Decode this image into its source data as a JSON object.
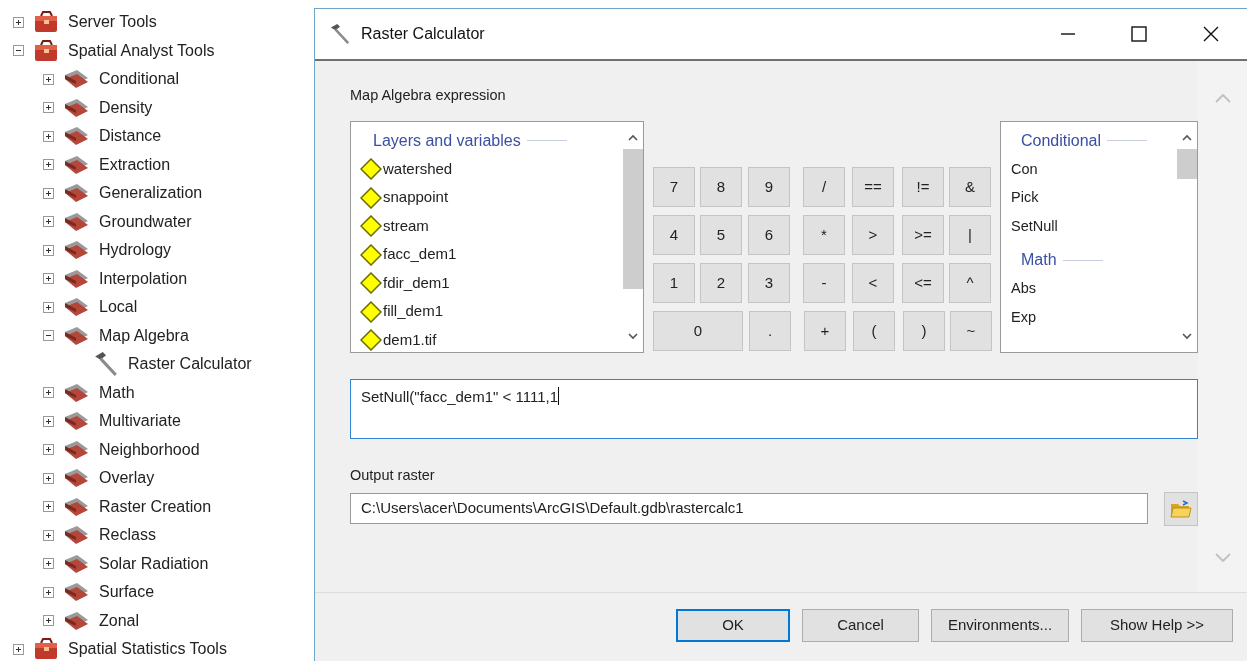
{
  "tree": [
    {
      "label": "Server Tools",
      "kind": "toolbox",
      "expanded": false
    },
    {
      "label": "Spatial Analyst Tools",
      "kind": "toolbox",
      "expanded": true,
      "children": [
        {
          "label": "Conditional",
          "kind": "toolset",
          "expanded": false
        },
        {
          "label": "Density",
          "kind": "toolset",
          "expanded": false
        },
        {
          "label": "Distance",
          "kind": "toolset",
          "expanded": false
        },
        {
          "label": "Extraction",
          "kind": "toolset",
          "expanded": false
        },
        {
          "label": "Generalization",
          "kind": "toolset",
          "expanded": false
        },
        {
          "label": "Groundwater",
          "kind": "toolset",
          "expanded": false
        },
        {
          "label": "Hydrology",
          "kind": "toolset",
          "expanded": false
        },
        {
          "label": "Interpolation",
          "kind": "toolset",
          "expanded": false
        },
        {
          "label": "Local",
          "kind": "toolset",
          "expanded": false
        },
        {
          "label": "Map Algebra",
          "kind": "toolset",
          "expanded": true,
          "children": [
            {
              "label": "Raster Calculator",
              "kind": "tool"
            }
          ]
        },
        {
          "label": "Math",
          "kind": "toolset",
          "expanded": false
        },
        {
          "label": "Multivariate",
          "kind": "toolset",
          "expanded": false
        },
        {
          "label": "Neighborhood",
          "kind": "toolset",
          "expanded": false
        },
        {
          "label": "Overlay",
          "kind": "toolset",
          "expanded": false
        },
        {
          "label": "Raster Creation",
          "kind": "toolset",
          "expanded": false
        },
        {
          "label": "Reclass",
          "kind": "toolset",
          "expanded": false
        },
        {
          "label": "Solar Radiation",
          "kind": "toolset",
          "expanded": false
        },
        {
          "label": "Surface",
          "kind": "toolset",
          "expanded": false
        },
        {
          "label": "Zonal",
          "kind": "toolset",
          "expanded": false
        }
      ]
    },
    {
      "label": "Spatial Statistics Tools",
      "kind": "toolbox",
      "expanded": false
    }
  ],
  "window": {
    "title": "Raster Calculator"
  },
  "expression_label": "Map Algebra expression",
  "layers": {
    "header": "Layers and variables",
    "items": [
      "watershed",
      "snappoint",
      "stream",
      "facc_dem1",
      "fdir_dem1",
      "fill_dem1",
      "dem1.tif"
    ]
  },
  "keypad": [
    [
      {
        "label": "7",
        "kind": "normal"
      },
      {
        "label": "8",
        "kind": "normal"
      },
      {
        "label": "9",
        "kind": "normal"
      },
      {
        "label": "/",
        "kind": "normal"
      },
      {
        "label": "==",
        "kind": "normal"
      },
      {
        "label": "!=",
        "kind": "normal"
      },
      {
        "label": "&",
        "kind": "normal"
      }
    ],
    [
      {
        "label": "4",
        "kind": "normal"
      },
      {
        "label": "5",
        "kind": "normal"
      },
      {
        "label": "6",
        "kind": "normal"
      },
      {
        "label": "*",
        "kind": "normal"
      },
      {
        "label": ">",
        "kind": "normal"
      },
      {
        "label": ">=",
        "kind": "normal"
      },
      {
        "label": "|",
        "kind": "normal"
      }
    ],
    [
      {
        "label": "1",
        "kind": "normal"
      },
      {
        "label": "2",
        "kind": "normal"
      },
      {
        "label": "3",
        "kind": "normal"
      },
      {
        "label": "-",
        "kind": "normal"
      },
      {
        "label": "<",
        "kind": "normal"
      },
      {
        "label": "<=",
        "kind": "normal"
      },
      {
        "label": "^",
        "kind": "normal"
      }
    ],
    [
      {
        "label": "0",
        "kind": "wide"
      },
      {
        "label": ".",
        "kind": "normal"
      },
      {
        "label": "+",
        "kind": "normal"
      },
      {
        "label": "(",
        "kind": "normal"
      },
      {
        "label": ")",
        "kind": "normal"
      },
      {
        "label": "~",
        "kind": "normal"
      }
    ]
  ],
  "tools": [
    {
      "header": "Conditional",
      "items": [
        "Con",
        "Pick",
        "SetNull"
      ]
    },
    {
      "header": "Math",
      "items": [
        "Abs",
        "Exp"
      ]
    }
  ],
  "expression": "SetNull(\"facc_dem1\" < 1111,1",
  "output": {
    "label": "Output raster",
    "value": "C:\\Users\\acer\\Documents\\ArcGIS\\Default.gdb\\rastercalc1"
  },
  "buttons": [
    {
      "label": "OK",
      "default": true
    },
    {
      "label": "Cancel",
      "default": false
    },
    {
      "label": "Environments...",
      "default": false
    },
    {
      "label": "Show Help >>",
      "default": false
    }
  ]
}
